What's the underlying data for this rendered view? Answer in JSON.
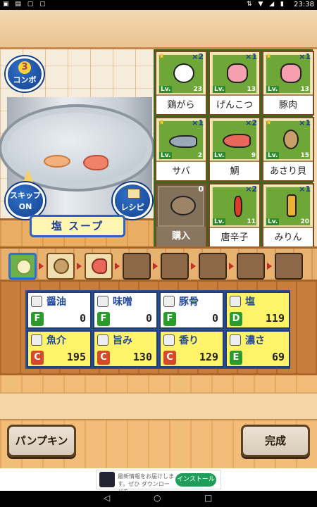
{
  "status_bar": {
    "time": "23:38",
    "icons": [
      "sim-icon",
      "wifi-icon",
      "signal-icon",
      "battery-icon"
    ]
  },
  "pot": {
    "combo": {
      "count": "3",
      "label": "コンボ"
    },
    "skip_label": "スキップ\nON",
    "skip_line1": "スキップ",
    "skip_line2": "ON",
    "recipe_label": "レシピ",
    "soup_name": "塩 スープ"
  },
  "ingredients": [
    {
      "name": "鶏がら",
      "count": "2",
      "lv": "23",
      "icon": "chicken-icon",
      "star": true
    },
    {
      "name": "げんこつ",
      "count": "1",
      "lv": "13",
      "icon": "pig-icon",
      "star": false
    },
    {
      "name": "豚肉",
      "count": "1",
      "lv": "13",
      "icon": "pig-icon",
      "star": true
    },
    {
      "name": "サバ",
      "count": "1",
      "lv": "2",
      "icon": "mackerel-icon",
      "star": true
    },
    {
      "name": "鯛",
      "count": "2",
      "lv": "9",
      "icon": "sea-bream-icon",
      "star": false
    },
    {
      "name": "あさり貝",
      "count": "1",
      "lv": "15",
      "icon": "clam-icon",
      "star": true
    },
    {
      "name": "購入",
      "count": "0",
      "lv": "",
      "icon": "lock-icon",
      "star": false,
      "locked": true
    },
    {
      "name": "唐辛子",
      "count": "2",
      "lv": "11",
      "icon": "chili-icon",
      "star": false
    },
    {
      "name": "みりん",
      "count": "1",
      "lv": "20",
      "icon": "mirin-bottle-icon",
      "star": false
    }
  ],
  "sequence": {
    "filled_count": 3,
    "total_slots": 8
  },
  "stats": [
    {
      "name": "醤油",
      "grade": "F",
      "value": "0",
      "grade_color": "#2d9a2d",
      "icon": "soy-icon",
      "highlight": false
    },
    {
      "name": "味噌",
      "grade": "F",
      "value": "0",
      "grade_color": "#2d9a2d",
      "icon": "miso-icon",
      "highlight": false
    },
    {
      "name": "豚骨",
      "grade": "F",
      "value": "0",
      "grade_color": "#2d9a2d",
      "icon": "pork-bone-icon",
      "highlight": false
    },
    {
      "name": "塩",
      "grade": "D",
      "value": "119",
      "grade_color": "#2d9a2d",
      "icon": "salt-icon",
      "highlight": true
    },
    {
      "name": "魚介",
      "grade": "C",
      "value": "195",
      "grade_color": "#d64a2a",
      "icon": "seafood-icon",
      "highlight": true
    },
    {
      "name": "旨み",
      "grade": "C",
      "value": "130",
      "grade_color": "#d64a2a",
      "icon": "umami-icon",
      "highlight": true
    },
    {
      "name": "香り",
      "grade": "C",
      "value": "129",
      "grade_color": "#d64a2a",
      "icon": "aroma-icon",
      "highlight": true
    },
    {
      "name": "濃さ",
      "grade": "E",
      "value": "69",
      "grade_color": "#2d9a2d",
      "icon": "richness-icon",
      "highlight": true
    }
  ],
  "buttons": {
    "left": "パンプキン",
    "right": "完成"
  },
  "ad": {
    "text": "最新情報をお届けします。ぜひ ダウンロードを。",
    "button": "インストール"
  }
}
